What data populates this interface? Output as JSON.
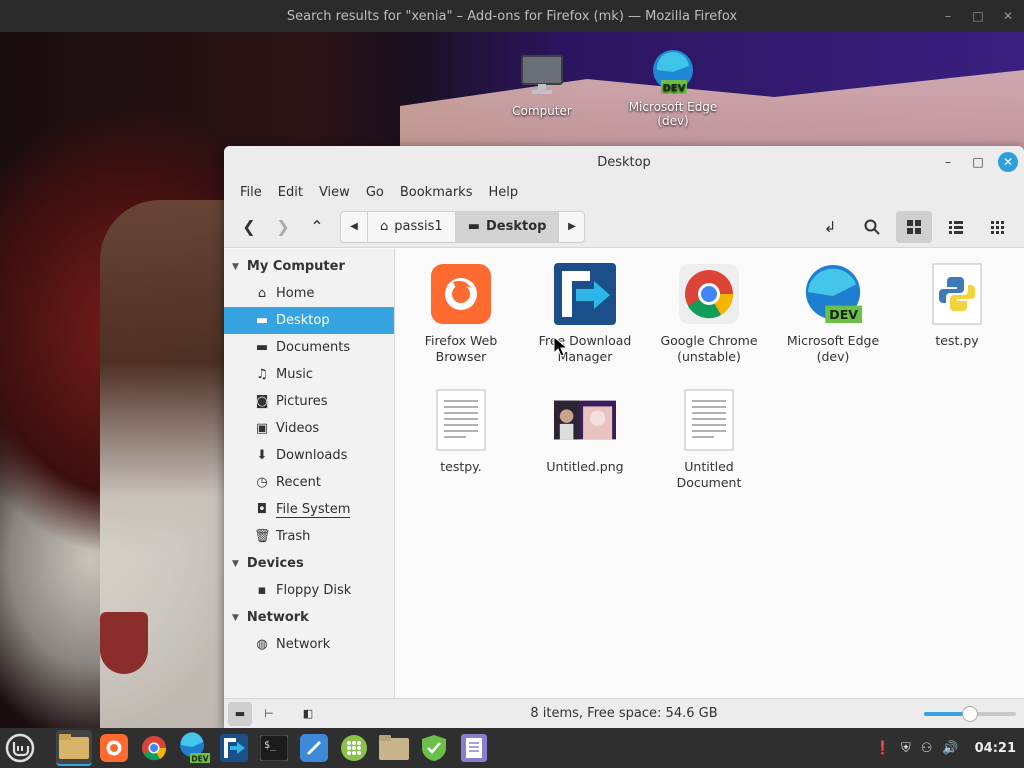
{
  "background_window": {
    "title": "Search results for \"xenia\" – Add-ons for Firefox (mk) — Mozilla Firefox"
  },
  "desktop_icons": [
    {
      "label": "Computer",
      "icon": "monitor-icon"
    },
    {
      "label": "Microsoft Edge (dev)",
      "icon": "edge-dev-icon"
    }
  ],
  "file_manager": {
    "title": "Desktop",
    "menu": [
      "File",
      "Edit",
      "View",
      "Go",
      "Bookmarks",
      "Help"
    ],
    "breadcrumbs": [
      "passis1",
      "Desktop"
    ],
    "sidebar": {
      "sections": [
        {
          "heading": "My Computer",
          "items": [
            {
              "label": "Home",
              "icon": "home-icon"
            },
            {
              "label": "Desktop",
              "icon": "desktop-icon",
              "selected": true
            },
            {
              "label": "Documents",
              "icon": "documents-icon"
            },
            {
              "label": "Music",
              "icon": "music-icon"
            },
            {
              "label": "Pictures",
              "icon": "camera-icon"
            },
            {
              "label": "Videos",
              "icon": "film-icon"
            },
            {
              "label": "Downloads",
              "icon": "download-icon"
            },
            {
              "label": "Recent",
              "icon": "clock-icon"
            },
            {
              "label": "File System",
              "icon": "drive-icon"
            },
            {
              "label": "Trash",
              "icon": "trash-icon"
            }
          ]
        },
        {
          "heading": "Devices",
          "items": [
            {
              "label": "Floppy Disk",
              "icon": "floppy-icon"
            }
          ]
        },
        {
          "heading": "Network",
          "items": [
            {
              "label": "Network",
              "icon": "globe-icon"
            }
          ]
        }
      ]
    },
    "files": [
      {
        "name": "Firefox Web Browser",
        "icon": "firefox-icon"
      },
      {
        "name": "Free Download Manager",
        "icon": "fdm-icon"
      },
      {
        "name": "Google Chrome (unstable)",
        "icon": "chrome-icon"
      },
      {
        "name": "Microsoft Edge (dev)",
        "icon": "edge-dev-icon"
      },
      {
        "name": "test.py",
        "icon": "python-file-icon"
      },
      {
        "name": "testpy.",
        "icon": "text-file-icon"
      },
      {
        "name": "Untitled.png",
        "icon": "image-thumbnail-icon"
      },
      {
        "name": "Untitled Document",
        "icon": "text-file-icon"
      }
    ],
    "status": "8 items, Free space: 54.6 GB",
    "zoom_level": 0.5
  },
  "taskbar": {
    "edge_badge": "DEV",
    "clock": "04:21"
  },
  "colors": {
    "selection": "#35a4e0",
    "close_button": "#2d9fe0",
    "taskbar": "#2f2f2f"
  }
}
